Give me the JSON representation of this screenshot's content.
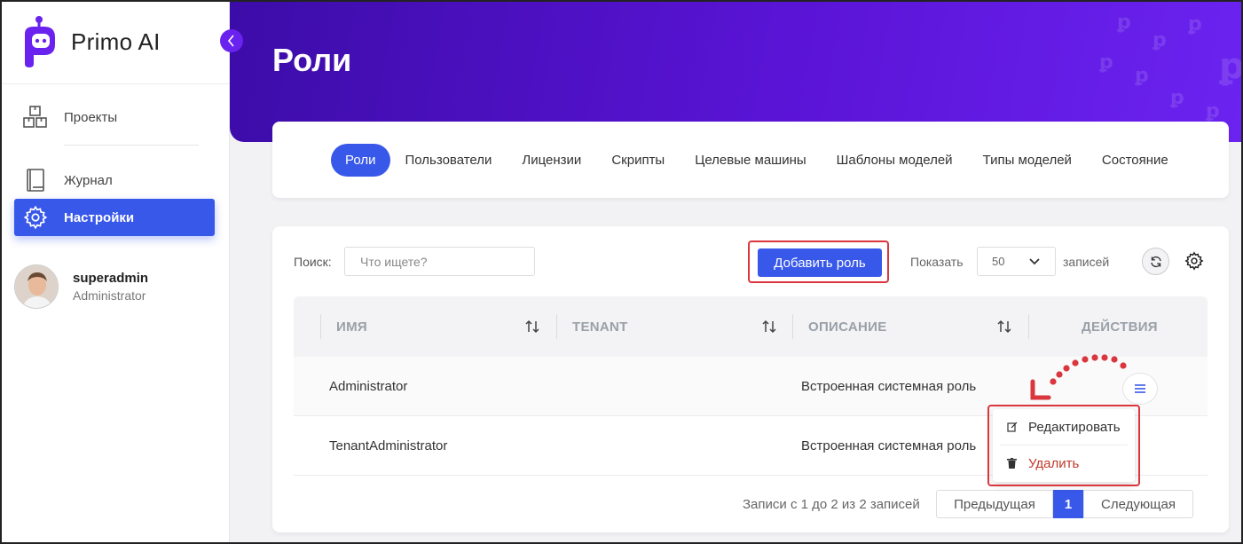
{
  "brand": {
    "name": "Primo AI"
  },
  "sidebar": {
    "items": [
      {
        "label": "Проекты",
        "icon": "boxes-icon"
      },
      {
        "label": "Журнал",
        "icon": "book-icon"
      },
      {
        "label": "Настройки",
        "icon": "gear-icon",
        "active": true
      }
    ],
    "user": {
      "name": "superadmin",
      "role": "Administrator"
    }
  },
  "header": {
    "title": "Роли"
  },
  "tabs": [
    {
      "label": "Роли",
      "active": true
    },
    {
      "label": "Пользователи"
    },
    {
      "label": "Лицензии"
    },
    {
      "label": "Скрипты"
    },
    {
      "label": "Целевые машины"
    },
    {
      "label": "Шаблоны моделей"
    },
    {
      "label": "Типы моделей"
    },
    {
      "label": "Состояние"
    }
  ],
  "toolbar": {
    "search_label": "Поиск:",
    "search_placeholder": "Что ищете?",
    "add_label": "Добавить роль",
    "show_label": "Показать",
    "page_size": "50",
    "records_label": "записей"
  },
  "table": {
    "columns": [
      "ИМЯ",
      "TENANT",
      "ОПИСАНИЕ",
      "ДЕЙСТВИЯ"
    ],
    "rows": [
      {
        "name": "Administrator",
        "tenant": "",
        "description": "Встроенная системная роль"
      },
      {
        "name": "TenantAdministrator",
        "tenant": "",
        "description": "Встроенная системная роль"
      }
    ]
  },
  "dropdown": {
    "edit": "Редактировать",
    "delete": "Удалить"
  },
  "pagination": {
    "info": "Записи с 1 до 2 из 2 записей",
    "prev": "Предыдущая",
    "current": "1",
    "next": "Следующая"
  },
  "colors": {
    "accent": "#3858e9",
    "header": "#5a14d6",
    "highlight": "#d9363e",
    "danger": "#c0392b"
  }
}
